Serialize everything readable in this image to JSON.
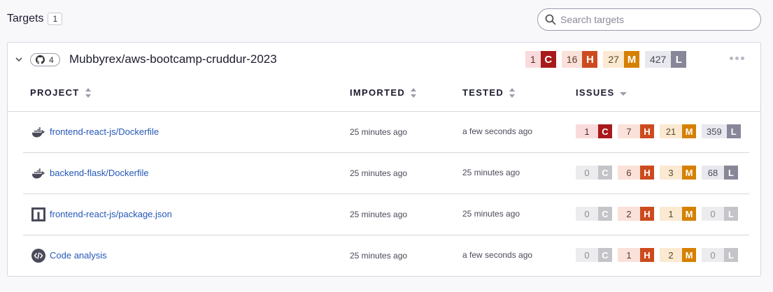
{
  "page": {
    "title": "Targets",
    "count": "1",
    "search_placeholder": "Search targets"
  },
  "target": {
    "repo_count": "4",
    "name": "Mubbyrex/aws-bootcamp-cruddur-2023",
    "severity": [
      {
        "count": "1",
        "letter": "C"
      },
      {
        "count": "16",
        "letter": "H"
      },
      {
        "count": "27",
        "letter": "M"
      },
      {
        "count": "427",
        "letter": "L"
      }
    ]
  },
  "columns": {
    "project": "PROJECT",
    "imported": "IMPORTED",
    "tested": "TESTED",
    "issues": "ISSUES"
  },
  "projects": [
    {
      "icon": "docker-icon",
      "name": "frontend-react-js/Dockerfile",
      "imported": "25 minutes ago",
      "tested": "a few seconds ago",
      "issues": [
        {
          "count": "1",
          "letter": "C"
        },
        {
          "count": "7",
          "letter": "H"
        },
        {
          "count": "21",
          "letter": "M"
        },
        {
          "count": "359",
          "letter": "L"
        }
      ]
    },
    {
      "icon": "docker-icon",
      "name": "backend-flask/Dockerfile",
      "imported": "25 minutes ago",
      "tested": "25 minutes ago",
      "issues": [
        {
          "count": "0",
          "letter": "C"
        },
        {
          "count": "6",
          "letter": "H"
        },
        {
          "count": "3",
          "letter": "M"
        },
        {
          "count": "68",
          "letter": "L"
        }
      ]
    },
    {
      "icon": "npm-icon",
      "name": "frontend-react-js/package.json",
      "imported": "25 minutes ago",
      "tested": "25 minutes ago",
      "issues": [
        {
          "count": "0",
          "letter": "C"
        },
        {
          "count": "2",
          "letter": "H"
        },
        {
          "count": "1",
          "letter": "M"
        },
        {
          "count": "0",
          "letter": "L"
        }
      ]
    },
    {
      "icon": "code-analysis-icon",
      "name": "Code analysis",
      "imported": "25 minutes ago",
      "tested": "a few seconds ago",
      "issues": [
        {
          "count": "0",
          "letter": "C"
        },
        {
          "count": "1",
          "letter": "H"
        },
        {
          "count": "2",
          "letter": "M"
        },
        {
          "count": "0",
          "letter": "L"
        }
      ]
    }
  ],
  "colors": {
    "critical": "#a8191b",
    "high": "#cc4b1e",
    "medium": "#d68000",
    "low": "#888799",
    "link": "#2457b8"
  }
}
